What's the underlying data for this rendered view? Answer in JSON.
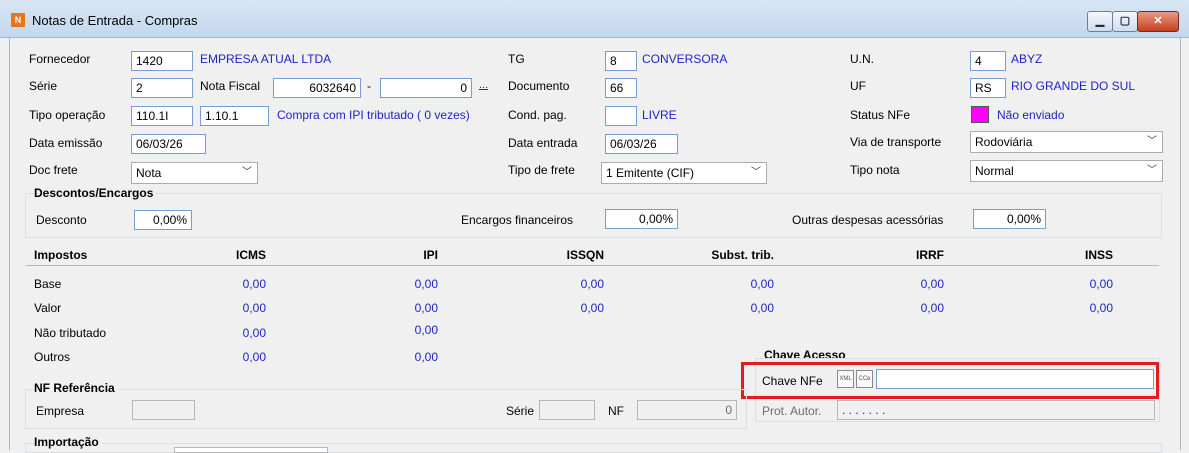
{
  "window": {
    "title": "Notas de Entrada - Compras",
    "app_icon": "app-logo-icon"
  },
  "header": {
    "fornecedor": {
      "label": "Fornecedor",
      "code": "1420",
      "name": "EMPRESA ATUAL LTDA"
    },
    "serie": {
      "label": "Série",
      "value": "2"
    },
    "nota_fiscal": {
      "label": "Nota Fiscal",
      "value": "6032640",
      "sep": "-",
      "dv": "0",
      "lookup": "..."
    },
    "tipo_operacao": {
      "label": "Tipo operação",
      "code": "110.1I",
      "cfop": "1.10.1",
      "desc": "Compra com IPI tributado ( 0 vezes)"
    },
    "data_emissao": {
      "label": "Data emissão",
      "value": "06/03/26"
    },
    "doc_frete": {
      "label": "Doc frete",
      "value": "Nota"
    },
    "tg": {
      "label": "TG",
      "code": "8",
      "name": "CONVERSORA"
    },
    "documento": {
      "label": "Documento",
      "value": "66"
    },
    "cond_pag": {
      "label": "Cond. pag.",
      "value": "",
      "desc": "LIVRE"
    },
    "data_entrada": {
      "label": "Data entrada",
      "value": "06/03/26"
    },
    "tipo_frete": {
      "label": "Tipo de frete",
      "value": "1 Emitente (CIF)"
    },
    "un": {
      "label": "U.N.",
      "code": "4",
      "name": "ABYZ"
    },
    "uf": {
      "label": "UF",
      "code": "RS",
      "name": "RIO GRANDE DO SUL"
    },
    "status_nfe": {
      "label": "Status NFe",
      "value": "Não enviado",
      "color": "#ff00ff"
    },
    "via_transporte": {
      "label": "Via de transporte",
      "value": "Rodoviária"
    },
    "tipo_nota": {
      "label": "Tipo nota",
      "value": "Normal"
    }
  },
  "descontos": {
    "title": "Descontos/Encargos",
    "desconto": {
      "label": "Desconto",
      "value": "0,00%"
    },
    "encargos": {
      "label": "Encargos financeiros",
      "value": "0,00%"
    },
    "outras": {
      "label": "Outras despesas acessórias",
      "value": "0,00%"
    }
  },
  "impostos": {
    "title": "Impostos",
    "columns": [
      "ICMS",
      "IPI",
      "ISSQN",
      "Subst. trib.",
      "IRRF",
      "INSS"
    ],
    "rows": [
      {
        "label": "Base",
        "values": [
          "0,00",
          "0,00",
          "0,00",
          "0,00",
          "0,00",
          "0,00"
        ]
      },
      {
        "label": "Valor",
        "values": [
          "0,00",
          "0,00",
          "0,00",
          "0,00",
          "0,00",
          "0,00"
        ]
      },
      {
        "label": "Não tributado",
        "values": [
          "0,00",
          "0,00"
        ]
      },
      {
        "label": "Outros",
        "values": [
          "0,00",
          "0,00"
        ]
      }
    ]
  },
  "chave_acesso": {
    "title": "Chave Acesso",
    "chave_label": "Chave NFe",
    "chave_value": "",
    "xml_icon": "XML",
    "cce_icon": "CCe",
    "prot_label": "Prot. Autor.",
    "prot_value": ". . . . . . ."
  },
  "nf_referencia": {
    "title": "NF Referência",
    "empresa_label": "Empresa",
    "empresa_value": "",
    "serie_label": "Série",
    "serie_value": "",
    "nf_label": "NF",
    "nf_value": "0"
  },
  "importacao": {
    "title": "Importação"
  }
}
